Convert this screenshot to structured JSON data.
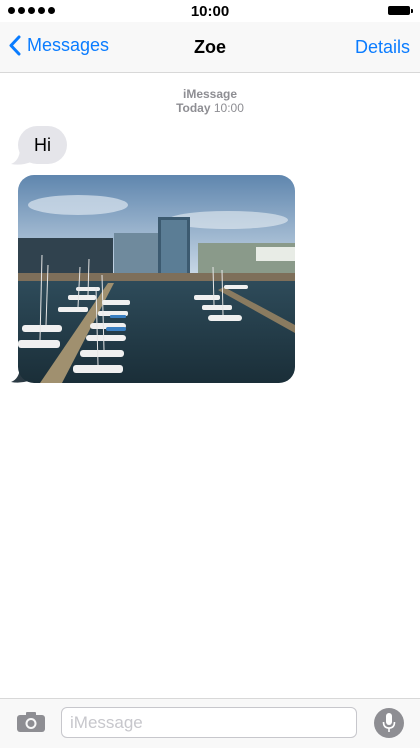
{
  "status_bar": {
    "time": "10:00",
    "signal_icon": "signal-dots-icon",
    "battery_icon": "battery-icon"
  },
  "nav": {
    "back_label": "Messages",
    "title": "Zoe",
    "details_label": "Details",
    "accent_color": "#0a7cff"
  },
  "conversation": {
    "service": "iMessage",
    "day": "Today",
    "time": "10:00",
    "messages": [
      {
        "type": "text",
        "direction": "incoming",
        "text": "Hi"
      },
      {
        "type": "image",
        "direction": "incoming",
        "description_icon": "harbor-photo"
      }
    ]
  },
  "input_bar": {
    "placeholder": "iMessage",
    "value": "",
    "camera_icon": "camera-icon",
    "mic_icon": "microphone-icon"
  }
}
